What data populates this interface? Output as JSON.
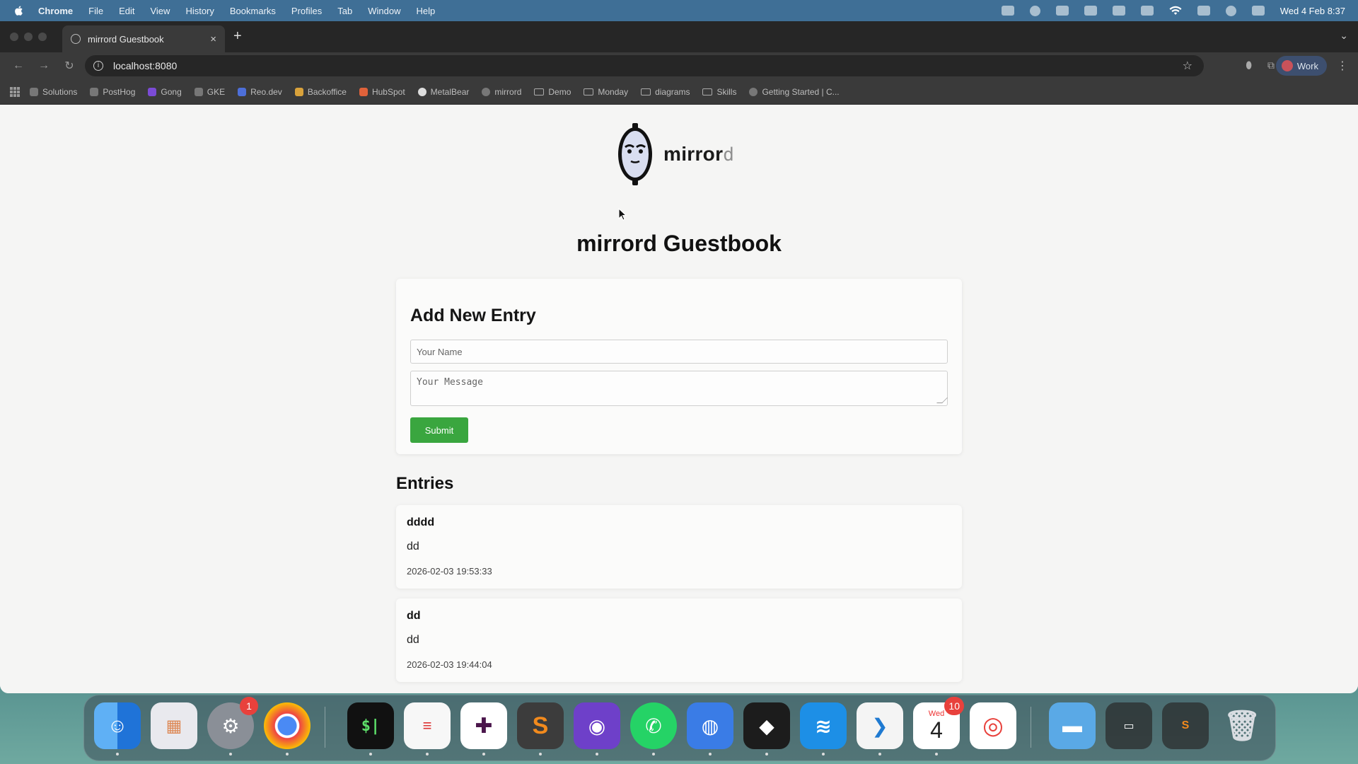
{
  "menubar": {
    "app": "Chrome",
    "items": [
      "File",
      "Edit",
      "View",
      "History",
      "Bookmarks",
      "Profiles",
      "Tab",
      "Window",
      "Help"
    ],
    "clock": "Wed 4 Feb  8:37"
  },
  "browser": {
    "tab_title": "mirrord Guestbook",
    "tab_close": "×",
    "new_tab": "+",
    "url": "localhost:8080",
    "profile": "Work",
    "bookmarks": [
      "Solutions",
      "PostHog",
      "Gong",
      "GKE",
      "Reo.dev",
      "Backoffice",
      "HubSpot",
      "MetalBear",
      "mirrord",
      "Demo",
      "Monday",
      "diagrams",
      "Skills",
      "Getting Started | C..."
    ]
  },
  "page": {
    "logo_text_main": "mirror",
    "logo_text_d": "d",
    "title": "mirrord Guestbook",
    "form": {
      "title": "Add New Entry",
      "name_placeholder": "Your Name",
      "message_placeholder": "Your Message",
      "submit_label": "Submit"
    },
    "entries_title": "Entries",
    "entries": [
      {
        "name": "dddd",
        "message": "dd",
        "timestamp": "2026-02-03 19:53:33"
      },
      {
        "name": "dd",
        "message": "dd",
        "timestamp": "2026-02-03 19:44:04"
      }
    ]
  },
  "dock": {
    "badges": {
      "system_settings": "1",
      "calendar": "10"
    },
    "calendar_day_label": "Wed",
    "calendar_day_number": "4"
  },
  "colors": {
    "submit": "#3aa63f",
    "menubar": "#3f6f96",
    "page_bg": "#f5f5f4"
  }
}
